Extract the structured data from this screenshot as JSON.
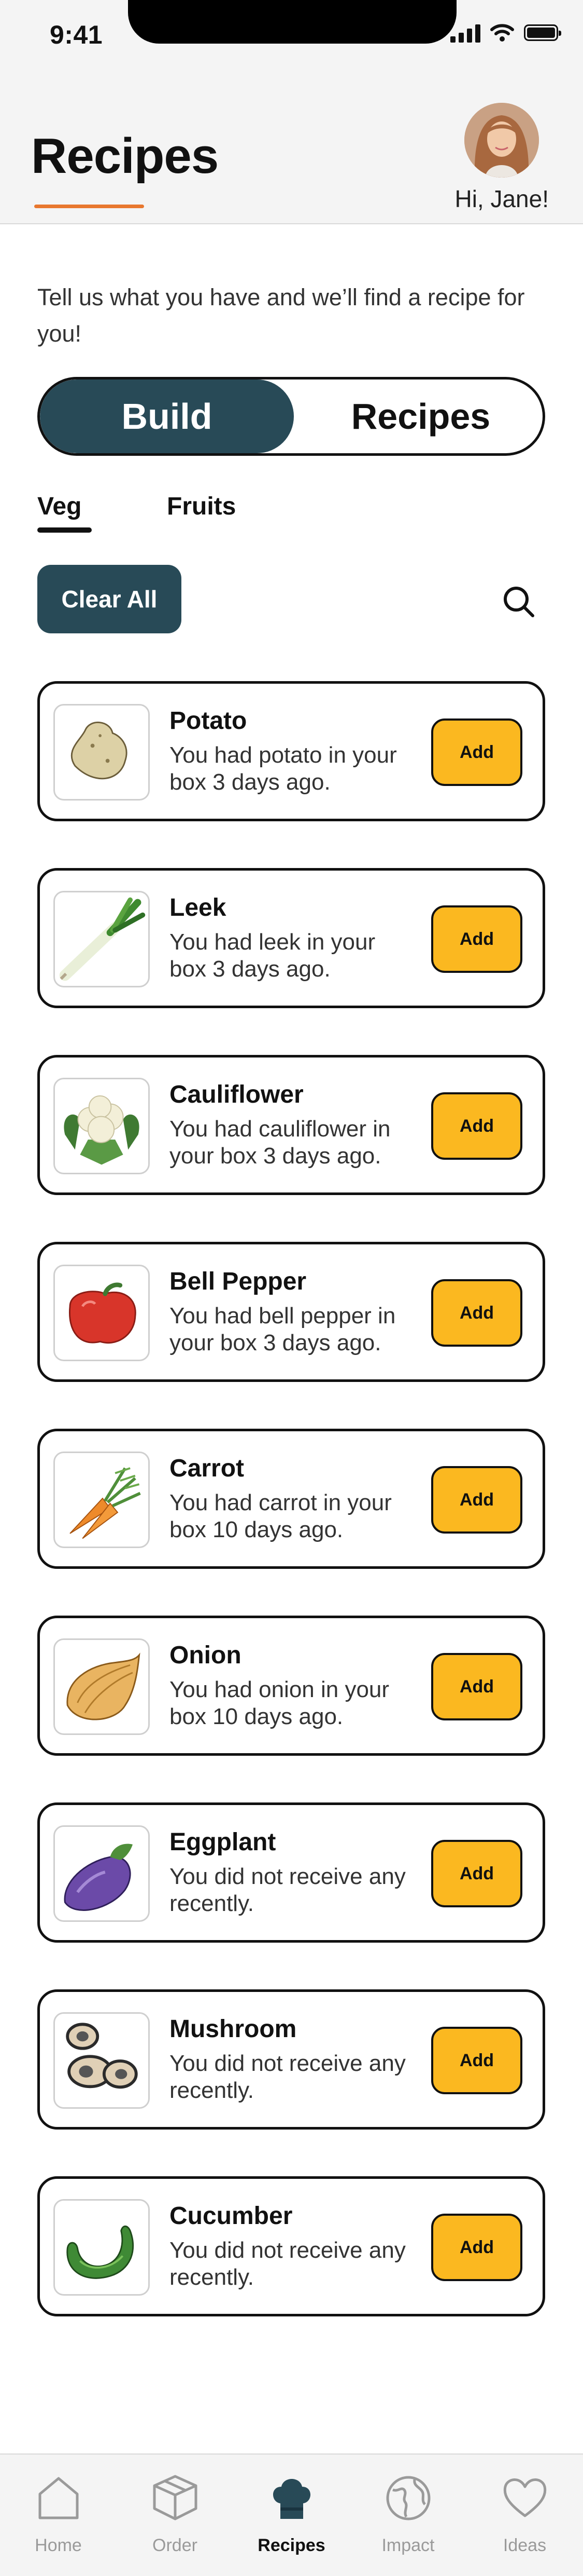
{
  "status_bar": {
    "time": "9:41"
  },
  "header": {
    "title": "Recipes",
    "greeting": "Hi, Jane!"
  },
  "intro": "Tell us what you have and we’ll find a recipe for you!",
  "mode_toggle": {
    "options": [
      "Build",
      "Recipes"
    ],
    "selected": "Build"
  },
  "tabs": [
    {
      "label": "Veg",
      "selected": true
    },
    {
      "label": "Fruits",
      "selected": false
    }
  ],
  "clear_all_label": "Clear All",
  "add_label": "Add",
  "items": [
    {
      "name": "Potato",
      "desc": "You had potato in your box 3 days ago.",
      "icon": "potato-icon"
    },
    {
      "name": "Leek",
      "desc": "You had leek in your box 3 days ago.",
      "icon": "leek-icon"
    },
    {
      "name": "Cauliflower",
      "desc": "You had cauliflower in your box 3 days ago.",
      "icon": "cauliflower-icon"
    },
    {
      "name": "Bell Pepper",
      "desc": "You had bell pepper in your box 3 days ago.",
      "icon": "bell-pepper-icon"
    },
    {
      "name": "Carrot",
      "desc": "You had carrot in your box 10 days ago.",
      "icon": "carrot-icon"
    },
    {
      "name": "Onion",
      "desc": "You had onion in your box 10 days ago.",
      "icon": "onion-icon"
    },
    {
      "name": "Eggplant",
      "desc": "You did not receive any recently.",
      "icon": "eggplant-icon"
    },
    {
      "name": "Mushroom",
      "desc": "You did not receive any recently.",
      "icon": "mushroom-icon"
    },
    {
      "name": "Cucumber",
      "desc": "You did not receive any recently.",
      "icon": "cucumber-icon"
    }
  ],
  "nav": [
    {
      "label": "Home",
      "icon": "home-icon",
      "active": false
    },
    {
      "label": "Order",
      "icon": "box-icon",
      "active": false
    },
    {
      "label": "Recipes",
      "icon": "chef-hat-icon",
      "active": true
    },
    {
      "label": "Impact",
      "icon": "globe-icon",
      "active": false
    },
    {
      "label": "Ideas",
      "icon": "heart-icon",
      "active": false
    }
  ],
  "colors": {
    "primary": "#284a57",
    "accent": "#e8772e",
    "add_button": "#fbb820"
  }
}
